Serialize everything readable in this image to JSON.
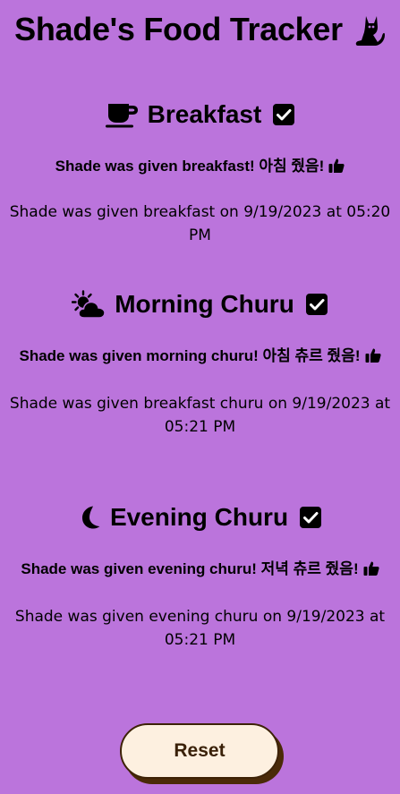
{
  "header": {
    "title": "Shade's Food Tracker",
    "cat_icon": "cat-icon"
  },
  "sections": [
    {
      "heading": "Breakfast",
      "icon": "coffee-cup-icon",
      "checked": true,
      "message": "Shade was given breakfast! 아침 줬음!",
      "timestamp": "Shade was given breakfast on 9/19/2023 at 05:20 PM"
    },
    {
      "heading": "Morning Churu",
      "icon": "cloud-sun-icon",
      "checked": true,
      "message": "Shade was given morning churu! 아침 츄르 줬음!",
      "timestamp": "Shade was given breakfast churu on 9/19/2023 at 05:21 PM"
    },
    {
      "heading": "Evening Churu",
      "icon": "moon-icon",
      "checked": true,
      "message": "Shade was given evening churu! 저녁 츄르 줬음!",
      "timestamp": "Shade was given evening churu on 9/19/2023 at 05:21 PM"
    }
  ],
  "reset_button": {
    "label": "Reset"
  },
  "colors": {
    "background": "#bb74dc",
    "button_fill": "#fdf0e0",
    "button_shadow": "#4a2a08"
  }
}
